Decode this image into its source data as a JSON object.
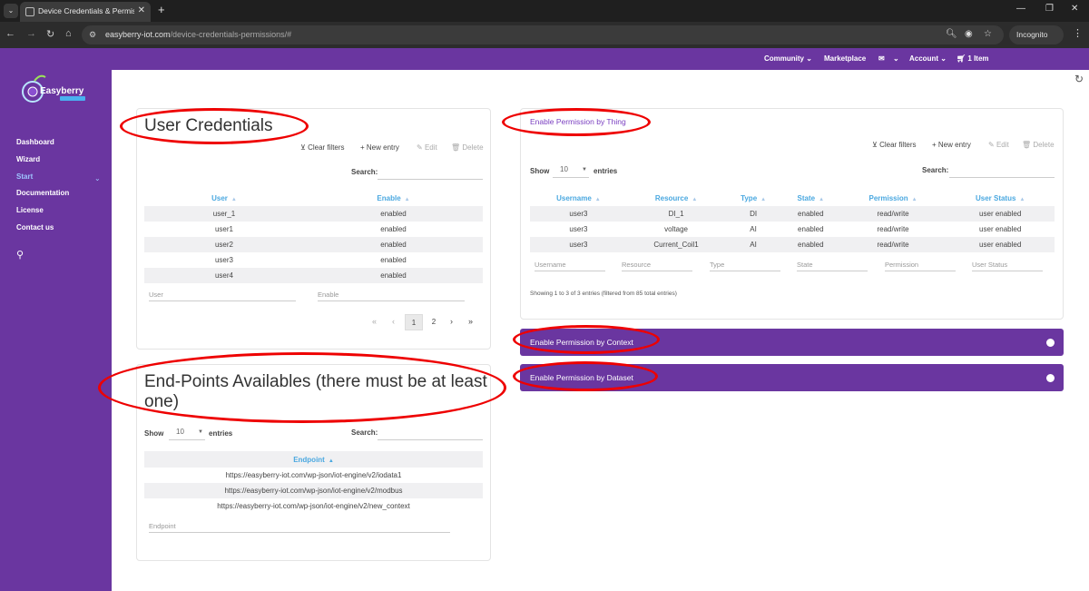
{
  "browser": {
    "tab_title": "Device Credentials & Permissions",
    "url_domain": "easyberry-iot.com",
    "url_path": "/device-credentials-permissions/#",
    "incognito_label": "Incognito"
  },
  "topnav": {
    "community": "Community",
    "marketplace": "Marketplace",
    "account": "Account",
    "cart": "1 Item"
  },
  "sidebar": {
    "logo_text": "Easyberry",
    "items": [
      "Dashboard",
      "Wizard",
      "Start",
      "Documentation",
      "License",
      "Contact us"
    ]
  },
  "user_credentials": {
    "title": "User Credentials",
    "clear_filters": "Clear filters",
    "new_entry": "New entry",
    "edit": "Edit",
    "delete": "Delete",
    "search_label": "Search:",
    "columns": [
      "User",
      "Enable"
    ],
    "rows": [
      [
        "user_1",
        "enabled"
      ],
      [
        "user1",
        "enabled"
      ],
      [
        "user2",
        "enabled"
      ],
      [
        "user3",
        "enabled"
      ],
      [
        "user4",
        "enabled"
      ]
    ],
    "filters": [
      "User",
      "Enable"
    ],
    "pages": [
      "1",
      "2"
    ]
  },
  "endpoints": {
    "title": "End-Points Availables (there must be at least one)",
    "show": "Show",
    "entries_value": "10",
    "entries": "entries",
    "search_label": "Search:",
    "column": "Endpoint",
    "rows": [
      "https://easyberry-iot.com/wp-json/iot-engine/v2/iodata1",
      "https://easyberry-iot.com/wp-json/iot-engine/v2/modbus",
      "https://easyberry-iot.com/wp-json/iot-engine/v2/new_context"
    ],
    "filter": "Endpoint"
  },
  "thing_permissions": {
    "title": "Enable Permission by Thing",
    "clear_filters": "Clear filters",
    "new_entry": "New entry",
    "edit": "Edit",
    "delete": "Delete",
    "show": "Show",
    "entries_value": "10",
    "entries": "entries",
    "search_label": "Search:",
    "columns": [
      "Username",
      "Resource",
      "Type",
      "State",
      "Permission",
      "User Status"
    ],
    "rows": [
      [
        "user3",
        "DI_1",
        "DI",
        "enabled",
        "read/write",
        "user enabled"
      ],
      [
        "user3",
        "voltage",
        "AI",
        "enabled",
        "read/write",
        "user enabled"
      ],
      [
        "user3",
        "Current_Coil1",
        "AI",
        "enabled",
        "read/write",
        "user enabled"
      ]
    ],
    "filters": [
      "Username",
      "Resource",
      "Type",
      "State",
      "Permission",
      "User Status"
    ],
    "info": "Showing 1 to 3 of 3 entries (filtered from 85 total entries)"
  },
  "accordions": {
    "context": "Enable Permission by Context",
    "dataset": "Enable Permission by Dataset"
  },
  "colors": {
    "brand_purple": "#6a36a0",
    "annotation_red": "#e00000",
    "header_blue": "#4aa8e0"
  }
}
